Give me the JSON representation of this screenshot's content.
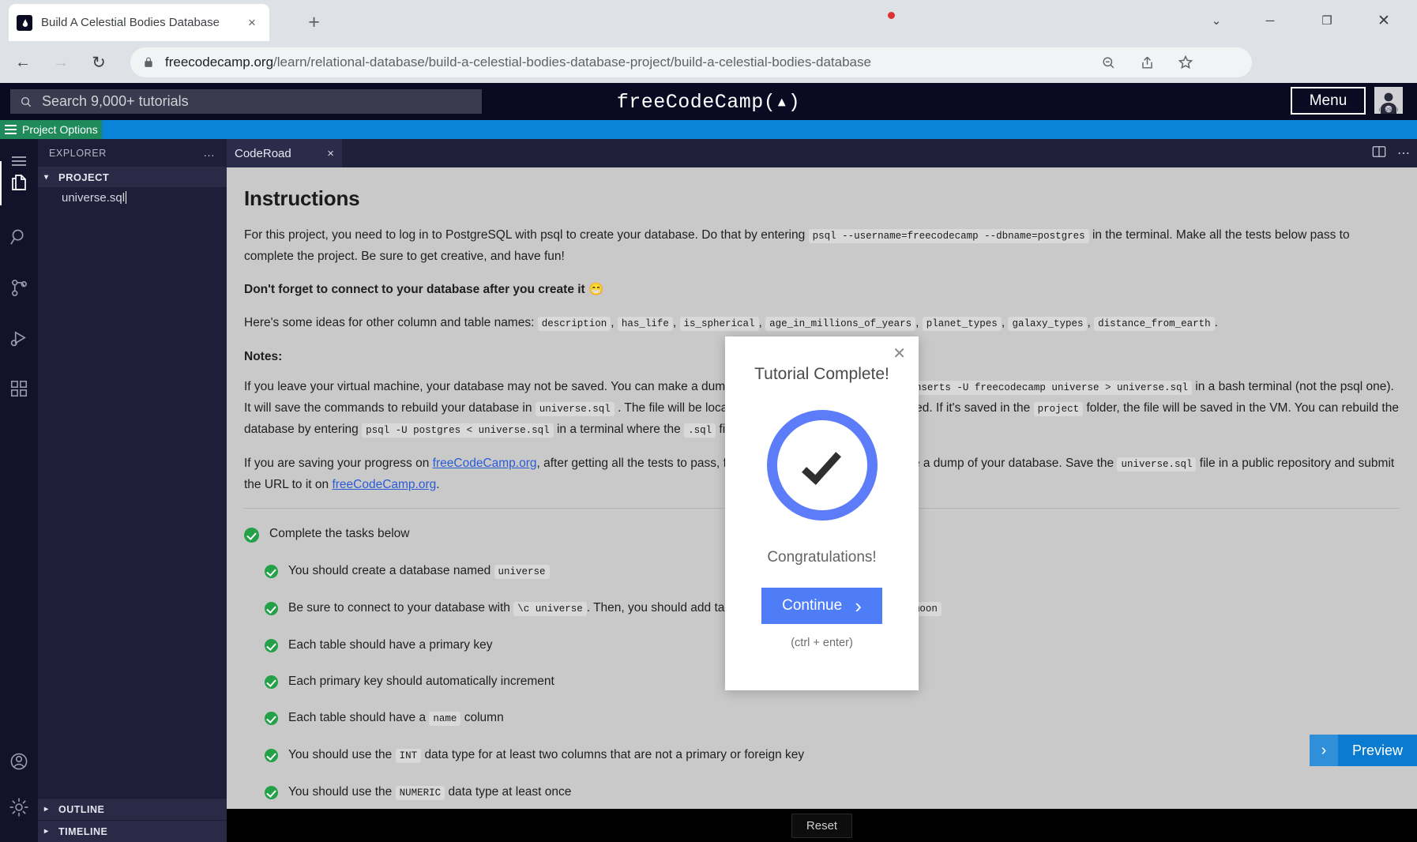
{
  "browser": {
    "tab": {
      "title": "Build A Celestial Bodies Database",
      "favicon": "fcc-flame-icon",
      "close": "×"
    },
    "newtab_label": "+",
    "window_controls": {
      "chevron": "⌄",
      "minimize": "─",
      "maximize": "❐",
      "close": "✕"
    },
    "nav": {
      "back": "←",
      "forward": "→",
      "reload": "↻"
    },
    "url_domain": "freecodecamp.org",
    "url_path": "/learn/relational-database/build-a-celestial-bodies-database-project/build-a-celestial-bodies-database",
    "toolbar_icons": [
      "zoom-out-icon",
      "share-icon",
      "bookmark-star-icon",
      "reading-list-icon",
      "extensions-puzzle-icon",
      "side-panel-icon",
      "profile-icon",
      "chrome-menu-icon"
    ],
    "reading_list_glyph": "{≡}",
    "chrome_menu_glyph": "⋮"
  },
  "fcc_header": {
    "search_placeholder": "Search 9,000+ tutorials",
    "logo": "freeCodeCamp(▴)",
    "logo_text": "freeCodeCamp",
    "menu_label": "Menu"
  },
  "project_options": {
    "label": "Project Options"
  },
  "vscode": {
    "activity_bar": [
      {
        "name": "menu-hamburger-icon"
      },
      {
        "name": "explorer-files-icon",
        "active": true
      },
      {
        "name": "search-icon"
      },
      {
        "name": "source-control-icon"
      },
      {
        "name": "run-and-debug-icon"
      },
      {
        "name": "extensions-icon"
      },
      {
        "name": "accounts-icon"
      },
      {
        "name": "settings-gear-icon"
      }
    ],
    "sidebar": {
      "title": "EXPLORER",
      "more_actions": "…",
      "section": "PROJECT",
      "files": [
        "universe.sql"
      ],
      "bottom_sections": [
        "OUTLINE",
        "TIMELINE"
      ]
    },
    "editor": {
      "tab_label": "CodeRoad",
      "tab_close": "×",
      "actions": [
        "split-editor-icon",
        "more-actions-icon"
      ]
    }
  },
  "coderoad": {
    "heading": "Instructions",
    "p1_a": "For this project, you need to log in to PostgreSQL with psql to create your database. Do that by entering",
    "p1_code": "psql --username=freecodecamp --dbname=postgres",
    "p1_b": "in the terminal. Make all the tests below pass to complete the project. Be sure to get creative, and have fun!",
    "p2": "Don't forget to connect to your database after you create it 😁",
    "p3_lead": "Here's some ideas for other column and table names:",
    "p3_codes": [
      "description",
      "has_life",
      "is_spherical",
      "age_in_millions_of_years",
      "planet_types",
      "galaxy_types",
      "distance_from_earth"
    ],
    "notes_label": "Notes:",
    "note1_a": "If you leave your virtual machine, your database may not be saved. You can make a dump of it by entering",
    "note1_code1": "pg_dump -cC --inserts -U freecodecamp universe > universe.sql",
    "note1_b": "in a bash terminal (not the psql one). It will save the commands to rebuild your database in",
    "note1_code2": "universe.sql",
    "note1_c": ". The file will be located where the command was entered. If it's saved in the",
    "note1_code3": "project",
    "note1_d": "folder, the file will be saved in the VM. You can rebuild the database by entering",
    "note1_code4": "psql -U postgres < universe.sql",
    "note1_e": "in a terminal where the",
    "note1_code5": ".sql",
    "note1_f": "file is.",
    "note2_a": "If you are saving your progress on",
    "note2_link1": "freeCodeCamp.org",
    "note2_b": ", after getting all the tests to pass, follow the instructions above to save a dump of your database. Save the",
    "note2_code": "universe.sql",
    "note2_c": "file in a public repository and submit the URL to it on",
    "note2_link2": "freeCodeCamp.org",
    "note2_d": ".",
    "tasks_heading": "Complete the tasks below",
    "tasks": [
      {
        "pre": "You should create a database named",
        "code": "universe",
        "post": ""
      },
      {
        "pre": "Be sure to connect to your database with",
        "code": "\\c universe",
        "post": ". Then, you should add tables named",
        "code2": "moon"
      },
      {
        "pre": "Each table should have a primary key",
        "code": "",
        "post": ""
      },
      {
        "pre": "Each primary key should automatically increment",
        "code": "",
        "post": ""
      },
      {
        "pre": "Each table should have a",
        "code": "name",
        "post": "column"
      },
      {
        "pre": "You should use the",
        "code": "INT",
        "post": "data type for at least two columns that are not a primary or foreign key"
      },
      {
        "pre": "You should use the",
        "code": "NUMERIC",
        "post": "data type at least once"
      }
    ],
    "preview_label": "Preview",
    "preview_arrow": "›",
    "reset_label": "Reset"
  },
  "modal": {
    "close": "✕",
    "title": "Tutorial Complete!",
    "icon": "check-circle-icon",
    "subtitle": "Congratulations!",
    "button_label": "Continue",
    "button_arrow": "›",
    "hint": "(ctrl + enter)"
  },
  "colors": {
    "fcc_navy": "#0a0a23",
    "accent_blue": "#0a7bd0",
    "modal_blue": "#4f7cf7",
    "check_green": "#24a148",
    "project_green": "#1f8a5a"
  }
}
